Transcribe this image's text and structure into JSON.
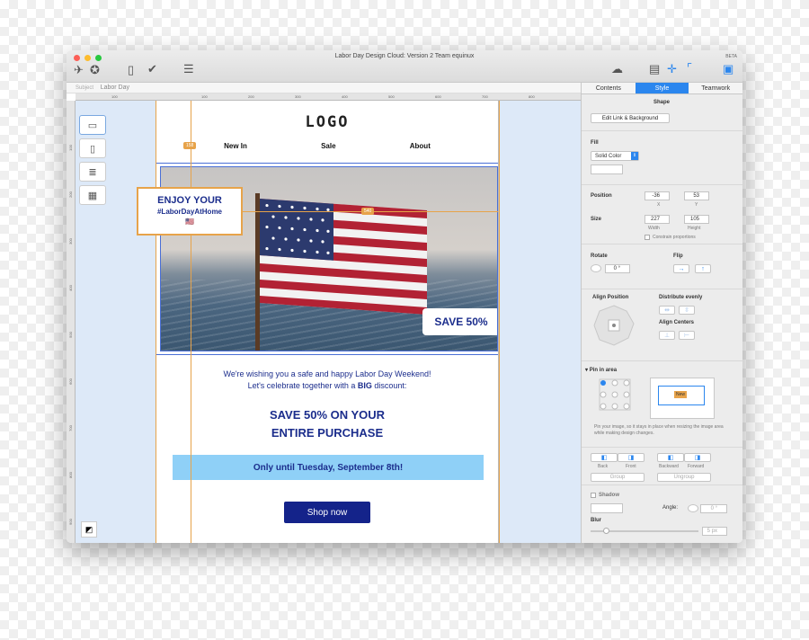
{
  "window": {
    "title": "Labor Day Design Cloud: Version 2 Team equinux",
    "beta": "BETA"
  },
  "toolbar": {
    "icons_left": [
      "airplane-icon",
      "stamp-icon",
      "devices-icon",
      "checkmark-icon",
      "chat-icon"
    ],
    "icons_right": [
      "cloud-icon",
      "layout-icon",
      "crosshair-icon",
      "corner-icon",
      "sidebar-icon"
    ]
  },
  "subject": {
    "label": "Subject",
    "value": "Labor Day"
  },
  "ruler": {
    "top_ticks": [
      "100",
      "100",
      "200",
      "300",
      "400",
      "500",
      "600",
      "700",
      "800"
    ],
    "left_ticks": [
      "100",
      "200",
      "300",
      "400",
      "500",
      "600",
      "700",
      "800",
      "900"
    ]
  },
  "email": {
    "logo": "LOGO",
    "nav": [
      "New In",
      "Sale",
      "About"
    ],
    "callout": {
      "line1": "ENJOY YOUR",
      "line2": "#LaborDayAtHome",
      "flag": "🇺🇸"
    },
    "save_badge": "SAVE 50%",
    "message": {
      "line1": "We're wishing you a safe and happy Labor Day Weekend!",
      "line2_pre": "Let's celebrate together with a ",
      "line2_bold": "BIG",
      "line2_post": " discount:"
    },
    "headline": {
      "line1": "SAVE 50% ON YOUR",
      "line2": "ENTIRE PURCHASE"
    },
    "banner": "Only until Tuesday, September 8th!",
    "cta": "Shop now"
  },
  "guides": {
    "vertical_label": "158",
    "horizontal_label": "540"
  },
  "inspector": {
    "tabs": [
      "Contents",
      "Style",
      "Teamwork"
    ],
    "active_tab": "Style",
    "shape_label": "Shape",
    "edit_link_button": "Edit Link & Background",
    "fill_label": "Fill",
    "fill_value": "Solid Color",
    "position_label": "Position",
    "position_x": "-36",
    "position_y": "53",
    "x_label": "X",
    "y_label": "Y",
    "size_label": "Size",
    "width": "227",
    "height": "105",
    "width_label": "Width",
    "height_label": "Height",
    "constrain_label": "Constrain proportions",
    "rotate_label": "Rotate",
    "rotate_value": "0 °",
    "flip_label": "Flip",
    "align_position_label": "Align Position",
    "distribute_label": "Distribute evenly",
    "align_centers_label": "Align Centers",
    "pin_label": "Pin in area",
    "pin_tag": "New",
    "pin_help": "Pin your image, so it stays in place when resizing the image area while making design changes.",
    "arrange_buttons": [
      "Back",
      "Front",
      "Backward",
      "Forward"
    ],
    "group_button": "Group",
    "ungroup_button": "Ungroup",
    "shadow_label": "Shadow",
    "angle_label": "Angle:",
    "angle_value": "0 °",
    "blur_label": "Blur",
    "blur_value": "5 px"
  },
  "colors": {
    "accent": "#2b86ee",
    "brand_navy": "#1b2d8c",
    "guide_orange": "#e7a34a",
    "banner_blue": "#8fd0f7"
  }
}
